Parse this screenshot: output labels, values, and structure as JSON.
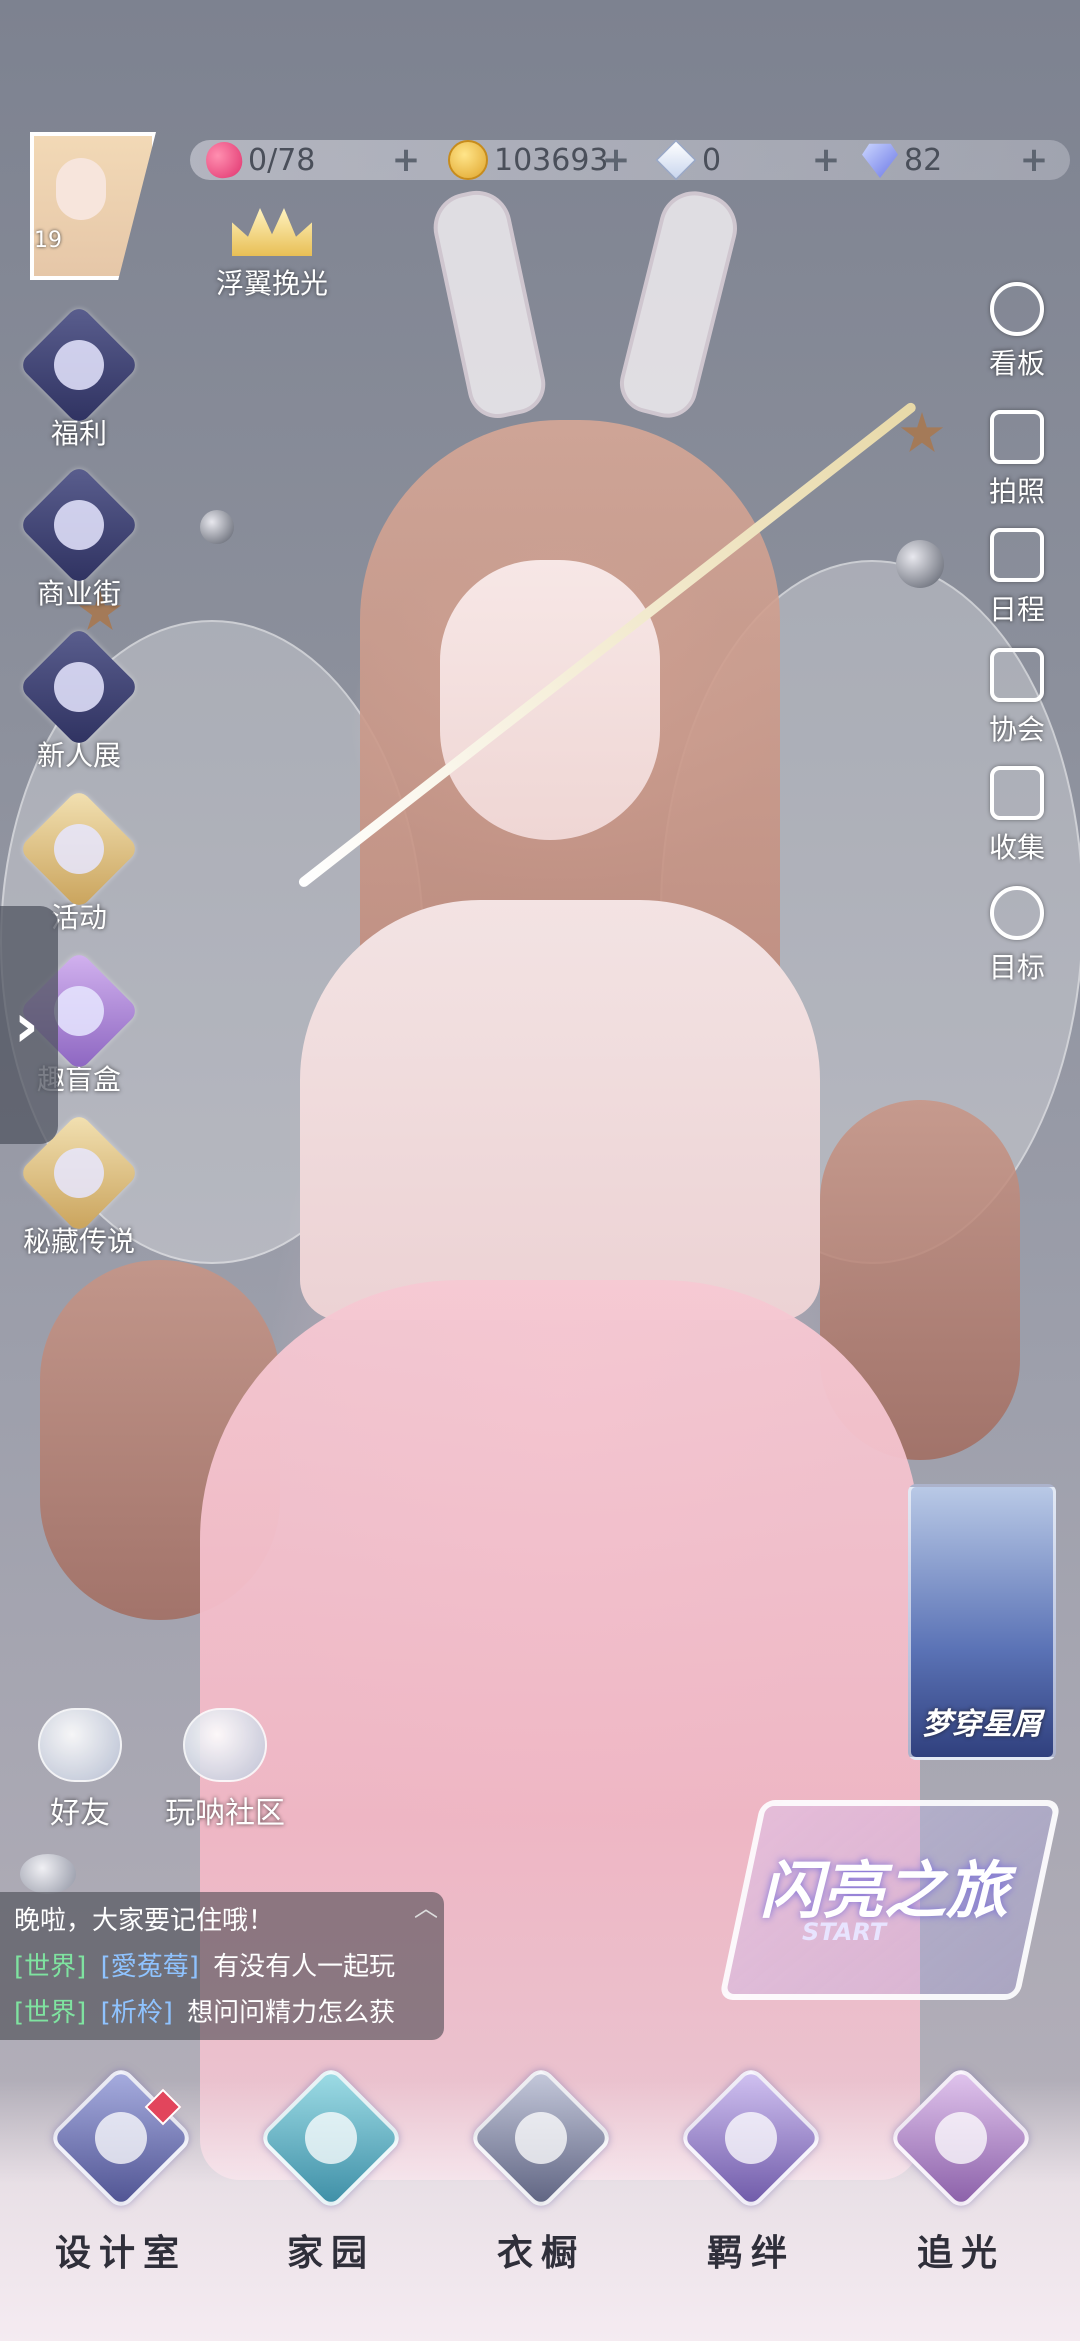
{
  "player": {
    "level": "19"
  },
  "resources": [
    {
      "id": "stamina",
      "icon": "heart-icon",
      "value": "0/78",
      "color": "#e0336e"
    },
    {
      "id": "gold",
      "icon": "coin-icon",
      "value": "103693",
      "color": "#e0a52c"
    },
    {
      "id": "white-diamond",
      "icon": "white-diamond-icon",
      "value": "0",
      "color": "#c9d6ee"
    },
    {
      "id": "blue-diamond",
      "icon": "blue-diamond-icon",
      "value": "82",
      "color": "#6b77e6"
    }
  ],
  "badge": {
    "label": "浮翼挽光"
  },
  "left_menu": [
    {
      "label": "福利",
      "icon": "hot-air-balloon-icon"
    },
    {
      "label": "商业街",
      "icon": "shopping-bag-icon"
    },
    {
      "label": "新人展",
      "icon": "trophy-icon"
    },
    {
      "label": "活动",
      "icon": "stars-icon"
    },
    {
      "label": "趣盲盒",
      "icon": "gift-box-icon"
    },
    {
      "label": "秘藏传说",
      "icon": "treasure-icon"
    }
  ],
  "right_menu": [
    {
      "label": "看板",
      "icon": "display-stand-icon"
    },
    {
      "label": "拍照",
      "icon": "camera-icon"
    },
    {
      "label": "日程",
      "icon": "calendar-check-icon"
    },
    {
      "label": "协会",
      "icon": "building-icon"
    },
    {
      "label": "收集",
      "icon": "collection-v-icon"
    },
    {
      "label": "目标",
      "icon": "target-heart-icon"
    }
  ],
  "event_card": {
    "title": "梦穿星屑"
  },
  "social": [
    {
      "label": "好友",
      "icon": "friends-icon"
    },
    {
      "label": "玩呐社区",
      "icon": "community-planet-icon"
    }
  ],
  "journey": {
    "title": "闪亮之旅",
    "subtitle": "START"
  },
  "chat": [
    {
      "channel": "",
      "name": "",
      "text": "晚啦，大家要记住哦！"
    },
    {
      "channel": "[世界]",
      "name": "[愛菟莓]",
      "text": "有没有人一起玩"
    },
    {
      "channel": "[世界]",
      "name": "[析柃]",
      "text": "想问问精力怎么获"
    }
  ],
  "bottom_nav": [
    {
      "label": "设计室",
      "icon": "moon-tower-icon",
      "color": "#6b6fa8"
    },
    {
      "label": "家园",
      "icon": "key-icon",
      "color": "#4e9fb2"
    },
    {
      "label": "衣橱",
      "icon": "snowflake-icon",
      "color": "#7a7f9a"
    },
    {
      "label": "羁绊",
      "icon": "clover-icon",
      "color": "#8a76b6"
    },
    {
      "label": "追光",
      "icon": "butterfly-icon",
      "color": "#a07ab8"
    }
  ]
}
